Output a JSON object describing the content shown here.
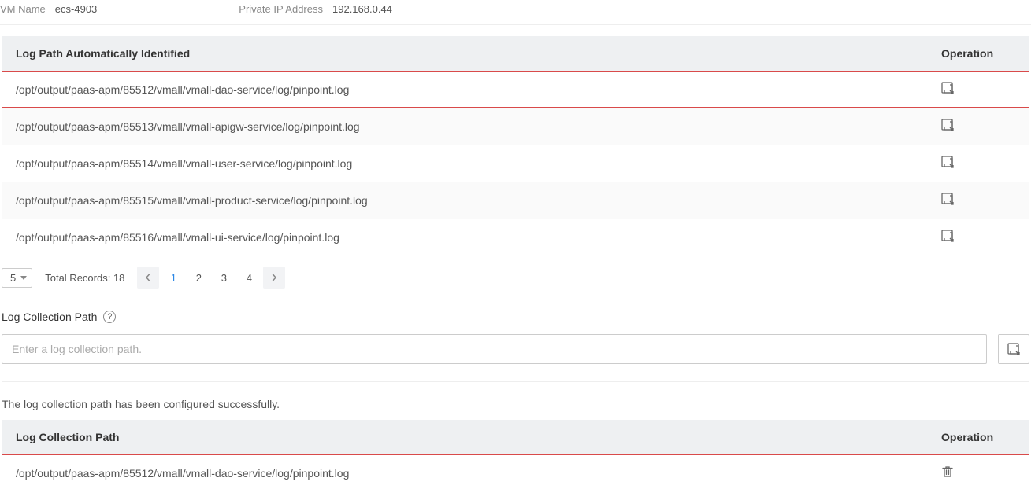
{
  "info": {
    "vm_name_label": "VM Name",
    "vm_name_value": "ecs-4903",
    "ip_label": "Private IP Address",
    "ip_value": "192.168.0.44"
  },
  "auto_table": {
    "header_path": "Log Path Automatically Identified",
    "header_op": "Operation",
    "rows": [
      "/opt/output/paas-apm/85512/vmall/vmall-dao-service/log/pinpoint.log",
      "/opt/output/paas-apm/85513/vmall/vmall-apigw-service/log/pinpoint.log",
      "/opt/output/paas-apm/85514/vmall/vmall-user-service/log/pinpoint.log",
      "/opt/output/paas-apm/85515/vmall/vmall-product-service/log/pinpoint.log",
      "/opt/output/paas-apm/85516/vmall/vmall-ui-service/log/pinpoint.log"
    ]
  },
  "pagination": {
    "page_size": "5",
    "total_label": "Total Records: 18",
    "pages": [
      "1",
      "2",
      "3",
      "4"
    ]
  },
  "path_section": {
    "label": "Log Collection Path",
    "placeholder": "Enter a log collection path."
  },
  "success_msg": "The log collection path has been configured successfully.",
  "coll_table": {
    "header_path": "Log Collection Path",
    "header_op": "Operation",
    "rows": [
      "/opt/output/paas-apm/85512/vmall/vmall-dao-service/log/pinpoint.log"
    ]
  }
}
